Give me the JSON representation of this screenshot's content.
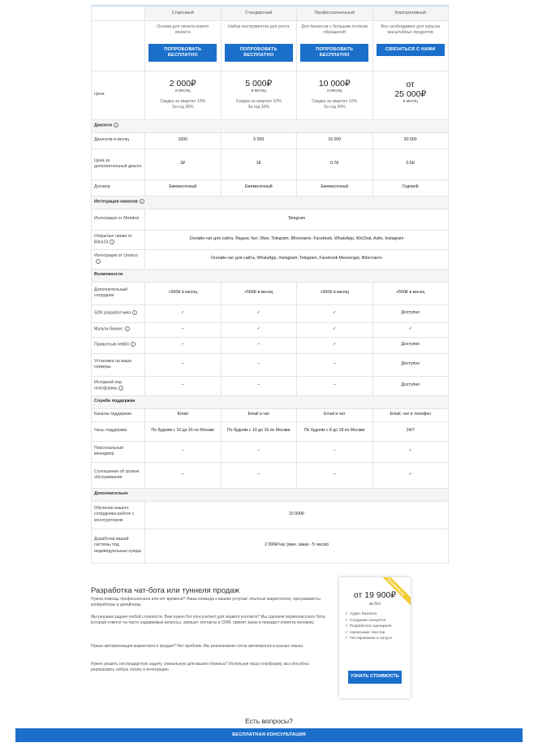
{
  "plans": [
    {
      "name": "Стартовый",
      "description": "Основа для начала нового проекта",
      "button": "ПОПРОБОВАТЬ БЕСПЛАТНО",
      "price": "2 000₽",
      "per_month": "в месяц",
      "discounts": [
        "Скидка за квартал 10%",
        "За год 30%"
      ]
    },
    {
      "name": "Стандартный",
      "description": "Набор инструментов для роста",
      "button": "ПОПРОБОВАТЬ БЕСПЛАТНО",
      "price": "5 000₽",
      "per_month": "в месяц",
      "discounts": [
        "Скидка за квартал 10%",
        "За год 30%"
      ]
    },
    {
      "name": "Профессиональный",
      "description": "Для бизнесов с большим потоком обращений",
      "button": "ПОПРОБОВАТЬ БЕСПЛАТНО",
      "price": "10 000₽",
      "per_month": "в месяц",
      "discounts": [
        "Скидка за квартал 10%",
        "За год 30%"
      ]
    },
    {
      "name": "Корпоративный",
      "description": "Все необходимое для запуска масштабных продуктов",
      "button": "СВЯЗАТЬСЯ С НАМИ",
      "price_prefix": "от",
      "price": "25 000₽",
      "per_month": "в месяц",
      "discounts": []
    }
  ],
  "price_label": "Цена",
  "sections": [
    {
      "title": "Диалоги",
      "info": true,
      "rows": [
        {
          "label": "Диалогов в месяц",
          "values": [
            "1000",
            "5 000",
            "15 000",
            "50 000"
          ]
        },
        {
          "label": "Цена за дополнительный диалог",
          "values": [
            "3₽",
            "1₽",
            "0.7₽",
            "0.5₽"
          ]
        },
        {
          "label": "Договор",
          "values": [
            "Ежемесячный",
            "Ежемесячный",
            "Ежемесячный",
            "Годовой"
          ]
        }
      ]
    },
    {
      "title": "Интеграции каналов",
      "info": true,
      "rows": [
        {
          "label": "Интеграции от Metabot",
          "span": "Telegram"
        },
        {
          "label": "Открытые линии от Bitrix24",
          "info": true,
          "span": "Онлайн-чат для сайта, Яндекс.Чат, Viber, Telegram, ВКонтакте, Facebook, WhatsApp, WeChat, Avito, Instagram"
        },
        {
          "label": "Интеграции от Umnico",
          "info": true,
          "span": "Онлайн-чат для сайта, WhatsApp, Instagram, Telegram, Facebook Messenger, ВКонтакте"
        }
      ]
    },
    {
      "title": "Возможности",
      "rows": [
        {
          "label": "Дополнительный сотрудник",
          "values": [
            "+500₽ в месяц",
            "+500₽ в месяц",
            "+500₽ в месяц",
            "+500₽ в месяц"
          ]
        },
        {
          "label": "SDK разработчика",
          "info": true,
          "values": [
            "✓",
            "✓",
            "✓",
            "Доступно"
          ]
        },
        {
          "label": "Мульти-бизнес",
          "info": true,
          "values": [
            "–",
            "✓",
            "✓",
            "✓"
          ]
        },
        {
          "label": "Приватный лейбл",
          "info": true,
          "values": [
            "–",
            "–",
            "✓",
            "Доступно"
          ]
        },
        {
          "label": "Установка на ваши серверы",
          "values": [
            "–",
            "–",
            "–",
            "Доступно"
          ]
        },
        {
          "label": "Исходный код платформы",
          "info": true,
          "values": [
            "–",
            "–",
            "–",
            "Доступно"
          ]
        }
      ]
    },
    {
      "title": "Служба поддержки",
      "rows": [
        {
          "label": "Каналы поддержки",
          "values": [
            "Email",
            "Email и чат",
            "Email и чат",
            "Email, чат и телефон"
          ]
        },
        {
          "label": "Часы поддержки",
          "values": [
            "По будням с 10 до 16 по Москве",
            "По будням с 10 до 16 по Москве",
            "По будням с 8 до 18 по Москве",
            "24/7"
          ]
        },
        {
          "label": "Персональный менеджер",
          "values": [
            "–",
            "–",
            "–",
            "✓"
          ]
        },
        {
          "label": "Соглашение об уровне обслуживания",
          "values": [
            "–",
            "–",
            "–",
            "✓"
          ]
        }
      ]
    },
    {
      "title": "Дополнительно",
      "rows": [
        {
          "label": "Обучение вашего сотрудника работе с конструктором",
          "span": "10 000₽"
        },
        {
          "label": "Доработки вашей системы под индивидуальные нужды",
          "span": "2 000₽/час (мин. заказ - 5 часов)"
        }
      ]
    }
  ],
  "promo": {
    "title": "Разработка чат-бота или туннеля продаж",
    "paragraphs": [
      "Нужна помощь профессионала или нет времени? Наша команда к вашим услугам: опытные маркетологи, программисты, копирайтеры и дизайнеры.",
      "Мы решаем задачи любой сложности. Вам нужен бот консультант для первого контакта? Мы сделаем первоклассного бота, который ответит на часто-задаваемые вопросы, запишет контакты в CRM, примет заказ и передаст клиента человеку.",
      "Нужна автоматизация маркетинга и продаж? Нет проблем. Мы реализовали сотни автоворонок в разных нишах.",
      "Нужно решить нестандартную задачу, уникальную для вашего бизнеса? Используя нашу платформу, мы способны реализовать любую логику и интеграцию."
    ]
  },
  "offer": {
    "ribbon": "Оптимально",
    "price": "от 19 900₽",
    "per": "за бот",
    "features": [
      "Аудит бизнеса",
      "Создание концепта",
      "Разработка сценариев",
      "Написание текстов",
      "Тестирование и запуск"
    ],
    "button": "УЗНАТЬ СТОИМОСТЬ"
  },
  "questions_title": "Есть вопросы?",
  "consult_button": "БЕСПЛАТНАЯ КОНСУЛЬТАЦИЯ"
}
